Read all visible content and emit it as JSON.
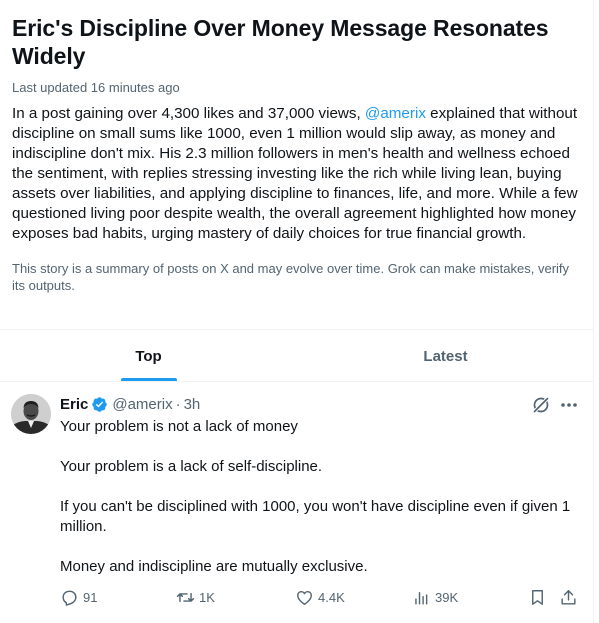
{
  "story": {
    "title": "Eric's Discipline Over Money Message Resonates Widely",
    "updated": "Last updated 16 minutes ago",
    "summary_pre": "In a post gaining over 4,300 likes and 37,000 views, ",
    "summary_mention": "@amerix",
    "summary_post": " explained that without discipline on small sums like 1000, even 1 million would slip away, as money and indiscipline don't mix. His 2.3 million followers in men's health and wellness echoed the sentiment, with replies stressing investing like the rich while living lean, buying assets over liabilities, and applying discipline to finances, life, and more. While a few questioned living poor despite wealth, the overall agreement highlighted how money exposes bad habits, urging mastery of daily choices for true financial growth.",
    "disclaimer": "This story is a summary of posts on X and may evolve over time. Grok can make mistakes, verify its outputs."
  },
  "tabs": [
    {
      "label": "Top",
      "active": true
    },
    {
      "label": "Latest",
      "active": false
    }
  ],
  "post": {
    "author": "Eric",
    "handle": "@amerix",
    "separator": "·",
    "time": "3h",
    "paragraphs": [
      "Your problem is not a lack of money",
      "Your problem is a lack of self-discipline.",
      "If you can't be disciplined with 1000, you won't have discipline even if given 1 million.",
      "Money and indiscipline are mutually exclusive."
    ],
    "stats": {
      "replies": "91",
      "reposts": "1K",
      "likes": "4.4K",
      "views": "39K"
    }
  },
  "colors": {
    "accent": "#1d9bf0",
    "secondary_text": "#536471",
    "primary_text": "#0f1419",
    "divider": "#eff3f4"
  },
  "icons": [
    "verified-badge-icon",
    "grok-icon",
    "more-icon",
    "reply-icon",
    "repost-icon",
    "like-icon",
    "views-icon",
    "bookmark-icon",
    "share-icon"
  ]
}
